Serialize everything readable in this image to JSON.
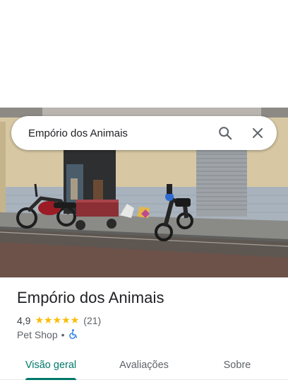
{
  "search": {
    "query": "Empório dos Animais"
  },
  "icons": {
    "search": "search-icon",
    "close": "close-icon",
    "accessibility": "wheelchair-icon",
    "star": "star-icon"
  },
  "place": {
    "name": "Empório dos Animais",
    "rating": "4,9",
    "rating_stars": 5,
    "review_count": "(21)",
    "category": "Pet Shop",
    "separator": "•",
    "wheelchair_accessible": true
  },
  "tabs": [
    {
      "label": "Visão geral",
      "active": true
    },
    {
      "label": "Avaliações",
      "active": false
    },
    {
      "label": "Sobre",
      "active": false
    }
  ],
  "colors": {
    "accent": "#00796b",
    "star": "#fbbc04",
    "accessibility": "#1a73e8",
    "text_primary": "#202124",
    "text_secondary": "#5f6368"
  }
}
